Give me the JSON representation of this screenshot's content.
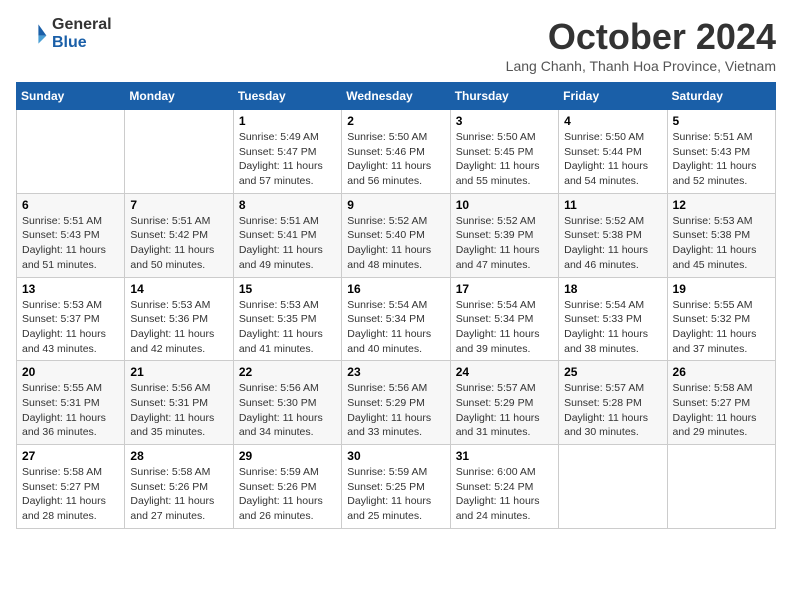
{
  "logo": {
    "line1": "General",
    "line2": "Blue"
  },
  "title": "October 2024",
  "subtitle": "Lang Chanh, Thanh Hoa Province, Vietnam",
  "header_days": [
    "Sunday",
    "Monday",
    "Tuesday",
    "Wednesday",
    "Thursday",
    "Friday",
    "Saturday"
  ],
  "weeks": [
    [
      {
        "day": "",
        "sunrise": "",
        "sunset": "",
        "daylight": ""
      },
      {
        "day": "",
        "sunrise": "",
        "sunset": "",
        "daylight": ""
      },
      {
        "day": "1",
        "sunrise": "Sunrise: 5:49 AM",
        "sunset": "Sunset: 5:47 PM",
        "daylight": "Daylight: 11 hours and 57 minutes."
      },
      {
        "day": "2",
        "sunrise": "Sunrise: 5:50 AM",
        "sunset": "Sunset: 5:46 PM",
        "daylight": "Daylight: 11 hours and 56 minutes."
      },
      {
        "day": "3",
        "sunrise": "Sunrise: 5:50 AM",
        "sunset": "Sunset: 5:45 PM",
        "daylight": "Daylight: 11 hours and 55 minutes."
      },
      {
        "day": "4",
        "sunrise": "Sunrise: 5:50 AM",
        "sunset": "Sunset: 5:44 PM",
        "daylight": "Daylight: 11 hours and 54 minutes."
      },
      {
        "day": "5",
        "sunrise": "Sunrise: 5:51 AM",
        "sunset": "Sunset: 5:43 PM",
        "daylight": "Daylight: 11 hours and 52 minutes."
      }
    ],
    [
      {
        "day": "6",
        "sunrise": "Sunrise: 5:51 AM",
        "sunset": "Sunset: 5:43 PM",
        "daylight": "Daylight: 11 hours and 51 minutes."
      },
      {
        "day": "7",
        "sunrise": "Sunrise: 5:51 AM",
        "sunset": "Sunset: 5:42 PM",
        "daylight": "Daylight: 11 hours and 50 minutes."
      },
      {
        "day": "8",
        "sunrise": "Sunrise: 5:51 AM",
        "sunset": "Sunset: 5:41 PM",
        "daylight": "Daylight: 11 hours and 49 minutes."
      },
      {
        "day": "9",
        "sunrise": "Sunrise: 5:52 AM",
        "sunset": "Sunset: 5:40 PM",
        "daylight": "Daylight: 11 hours and 48 minutes."
      },
      {
        "day": "10",
        "sunrise": "Sunrise: 5:52 AM",
        "sunset": "Sunset: 5:39 PM",
        "daylight": "Daylight: 11 hours and 47 minutes."
      },
      {
        "day": "11",
        "sunrise": "Sunrise: 5:52 AM",
        "sunset": "Sunset: 5:38 PM",
        "daylight": "Daylight: 11 hours and 46 minutes."
      },
      {
        "day": "12",
        "sunrise": "Sunrise: 5:53 AM",
        "sunset": "Sunset: 5:38 PM",
        "daylight": "Daylight: 11 hours and 45 minutes."
      }
    ],
    [
      {
        "day": "13",
        "sunrise": "Sunrise: 5:53 AM",
        "sunset": "Sunset: 5:37 PM",
        "daylight": "Daylight: 11 hours and 43 minutes."
      },
      {
        "day": "14",
        "sunrise": "Sunrise: 5:53 AM",
        "sunset": "Sunset: 5:36 PM",
        "daylight": "Daylight: 11 hours and 42 minutes."
      },
      {
        "day": "15",
        "sunrise": "Sunrise: 5:53 AM",
        "sunset": "Sunset: 5:35 PM",
        "daylight": "Daylight: 11 hours and 41 minutes."
      },
      {
        "day": "16",
        "sunrise": "Sunrise: 5:54 AM",
        "sunset": "Sunset: 5:34 PM",
        "daylight": "Daylight: 11 hours and 40 minutes."
      },
      {
        "day": "17",
        "sunrise": "Sunrise: 5:54 AM",
        "sunset": "Sunset: 5:34 PM",
        "daylight": "Daylight: 11 hours and 39 minutes."
      },
      {
        "day": "18",
        "sunrise": "Sunrise: 5:54 AM",
        "sunset": "Sunset: 5:33 PM",
        "daylight": "Daylight: 11 hours and 38 minutes."
      },
      {
        "day": "19",
        "sunrise": "Sunrise: 5:55 AM",
        "sunset": "Sunset: 5:32 PM",
        "daylight": "Daylight: 11 hours and 37 minutes."
      }
    ],
    [
      {
        "day": "20",
        "sunrise": "Sunrise: 5:55 AM",
        "sunset": "Sunset: 5:31 PM",
        "daylight": "Daylight: 11 hours and 36 minutes."
      },
      {
        "day": "21",
        "sunrise": "Sunrise: 5:56 AM",
        "sunset": "Sunset: 5:31 PM",
        "daylight": "Daylight: 11 hours and 35 minutes."
      },
      {
        "day": "22",
        "sunrise": "Sunrise: 5:56 AM",
        "sunset": "Sunset: 5:30 PM",
        "daylight": "Daylight: 11 hours and 34 minutes."
      },
      {
        "day": "23",
        "sunrise": "Sunrise: 5:56 AM",
        "sunset": "Sunset: 5:29 PM",
        "daylight": "Daylight: 11 hours and 33 minutes."
      },
      {
        "day": "24",
        "sunrise": "Sunrise: 5:57 AM",
        "sunset": "Sunset: 5:29 PM",
        "daylight": "Daylight: 11 hours and 31 minutes."
      },
      {
        "day": "25",
        "sunrise": "Sunrise: 5:57 AM",
        "sunset": "Sunset: 5:28 PM",
        "daylight": "Daylight: 11 hours and 30 minutes."
      },
      {
        "day": "26",
        "sunrise": "Sunrise: 5:58 AM",
        "sunset": "Sunset: 5:27 PM",
        "daylight": "Daylight: 11 hours and 29 minutes."
      }
    ],
    [
      {
        "day": "27",
        "sunrise": "Sunrise: 5:58 AM",
        "sunset": "Sunset: 5:27 PM",
        "daylight": "Daylight: 11 hours and 28 minutes."
      },
      {
        "day": "28",
        "sunrise": "Sunrise: 5:58 AM",
        "sunset": "Sunset: 5:26 PM",
        "daylight": "Daylight: 11 hours and 27 minutes."
      },
      {
        "day": "29",
        "sunrise": "Sunrise: 5:59 AM",
        "sunset": "Sunset: 5:26 PM",
        "daylight": "Daylight: 11 hours and 26 minutes."
      },
      {
        "day": "30",
        "sunrise": "Sunrise: 5:59 AM",
        "sunset": "Sunset: 5:25 PM",
        "daylight": "Daylight: 11 hours and 25 minutes."
      },
      {
        "day": "31",
        "sunrise": "Sunrise: 6:00 AM",
        "sunset": "Sunset: 5:24 PM",
        "daylight": "Daylight: 11 hours and 24 minutes."
      },
      {
        "day": "",
        "sunrise": "",
        "sunset": "",
        "daylight": ""
      },
      {
        "day": "",
        "sunrise": "",
        "sunset": "",
        "daylight": ""
      }
    ]
  ]
}
